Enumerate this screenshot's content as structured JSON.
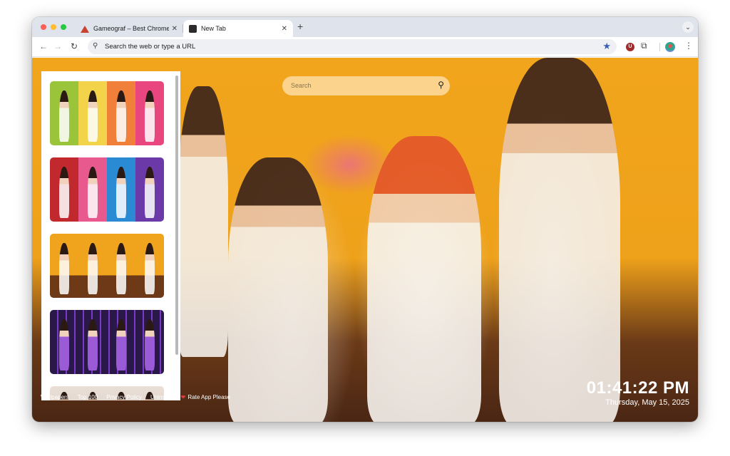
{
  "browser": {
    "tabs": [
      {
        "title": "Gameograf – Best Chrome Ext",
        "favicon": "gameograf-icon",
        "active": false
      },
      {
        "title": "New Tab",
        "favicon": "newtab-icon",
        "active": true
      }
    ],
    "new_tab_symbol": "+",
    "omnibox": {
      "placeholder": "Search the web or type a URL"
    },
    "extensions": {
      "u_badge": "U"
    }
  },
  "page": {
    "search": {
      "placeholder": "Search"
    },
    "footer_links": [
      "Wallpapers",
      "Top 100",
      "Privacy Policy",
      "Uninstall",
      "Rate App Please"
    ],
    "clock": {
      "time": "01:41:22 PM",
      "date": "Thursday, May 15, 2025"
    },
    "colors": {
      "background_accent": "#f1a51c",
      "search_bg": "#fdd796",
      "heart": "#e33b3b"
    }
  }
}
